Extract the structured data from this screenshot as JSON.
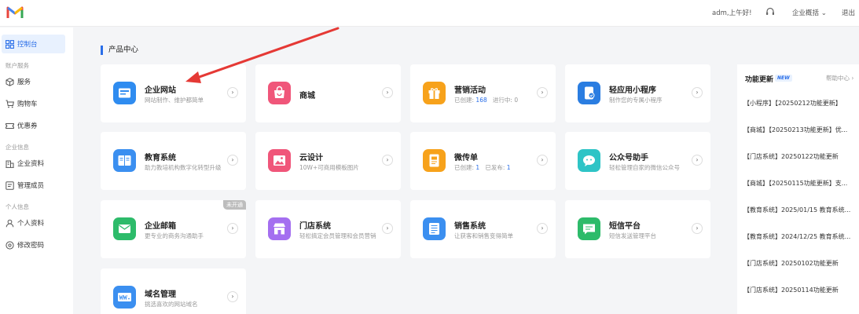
{
  "header": {
    "greeting": "adm,上午好!",
    "headset_icon": "headset-icon",
    "overview_label": "企业概括",
    "logout_label": "退出"
  },
  "sidebar": {
    "dashboard": "控制台",
    "groups": {
      "account": "账户服务",
      "company": "企业信息",
      "personal": "个人信息"
    },
    "items": {
      "service": "服务",
      "cart": "购物车",
      "coupon": "优惠券",
      "company_info": "企业资料",
      "members": "管理成员",
      "profile": "个人资料",
      "password": "修改密码"
    }
  },
  "main": {
    "section_title": "产品中心",
    "products": [
      {
        "title": "企业网站",
        "subtitle": "网站制作、维护都简单",
        "icon": "website-icon",
        "color": "#2f8cf0"
      },
      {
        "title": "商城",
        "subtitle": "",
        "icon": "shop-bag-icon",
        "color": "#f0567a"
      },
      {
        "title": "营销活动",
        "sub_prefix": "已创建:",
        "sub_num1": "168",
        "sub_mid": "进行中:",
        "sub_num2": "0",
        "icon": "gift-icon",
        "color": "#f7a21b"
      },
      {
        "title": "轻应用小程序",
        "subtitle": "制作您的专属小程序",
        "icon": "miniapp-icon",
        "color": "#2a7de1"
      },
      {
        "title": "教育系统",
        "subtitle": "助力教培机构数字化转型升级",
        "icon": "book-icon",
        "color": "#3b8ff0"
      },
      {
        "title": "云设计",
        "subtitle": "10W+可商用模板图片",
        "icon": "image-icon",
        "color": "#f0567a"
      },
      {
        "title": "微传单",
        "sub_prefix": "已创建:",
        "sub_num1": "1",
        "sub_mid": "已发布:",
        "sub_num2": "1",
        "icon": "flyer-icon",
        "color": "#f7a21b"
      },
      {
        "title": "公众号助手",
        "subtitle": "轻松管理自家的微信公众号",
        "icon": "wechat-icon",
        "color": "#2ec4c6"
      },
      {
        "title": "企业邮箱",
        "subtitle": "更专业的商务沟通助手",
        "badge": "未开通",
        "icon": "mail-icon",
        "color": "#2dbb6a"
      },
      {
        "title": "门店系统",
        "subtitle": "轻松搞定会员管理和会员营销",
        "icon": "store-icon",
        "color": "#a46ff0"
      },
      {
        "title": "销售系统",
        "subtitle": "让获客和销售变得简单",
        "icon": "list-icon",
        "color": "#3b8ff0"
      },
      {
        "title": "短信平台",
        "subtitle": "短信发送管理平台",
        "icon": "sms-icon",
        "color": "#2dbb6a"
      },
      {
        "title": "域名管理",
        "subtitle": "挑选喜欢的网站域名",
        "icon": "www-icon",
        "color": "#3b8ff0"
      }
    ],
    "arrow_glyph": "›"
  },
  "updates": {
    "title": "功能更新",
    "new_badge": "NEW",
    "help_label": "帮助中心 ›",
    "items": [
      "【小程序】【20250212功能更新】",
      "【商城】【20250213功能更新】优...",
      "【门店系统】20250122功能更新",
      "【商城】【20250115功能更新】支...",
      "【教育系统】2025/01/15 教育系统...",
      "【教育系统】2024/12/25 教育系统...",
      "【门店系统】20250102功能更新",
      "【门店系统】20250114功能更新"
    ]
  },
  "colors": {
    "accent": "#2a6ee8",
    "annotation_arrow": "#e53935"
  }
}
